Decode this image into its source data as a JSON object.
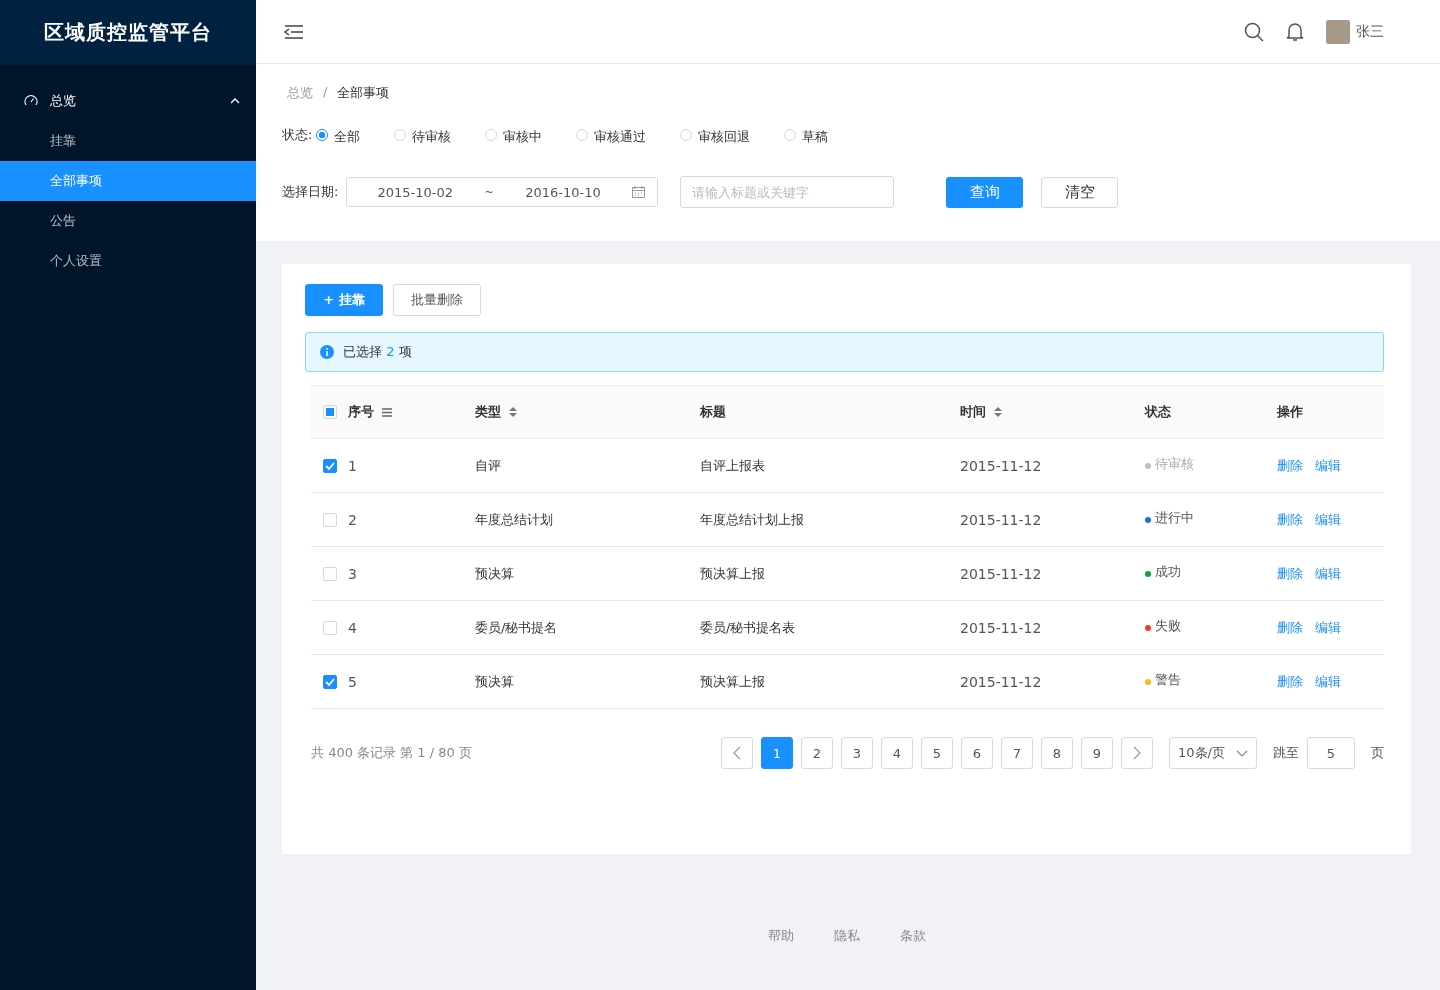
{
  "app": {
    "title": "区域质控监管平台"
  },
  "sidebar": {
    "items": [
      {
        "label": "总览",
        "expanded": true,
        "children": [
          {
            "label": "挂靠",
            "selected": false
          },
          {
            "label": "全部事项",
            "selected": true
          },
          {
            "label": "公告",
            "selected": false
          },
          {
            "label": "个人设置",
            "selected": false
          }
        ]
      }
    ]
  },
  "header": {
    "user": "张三"
  },
  "breadcrumb": [
    "总览",
    "全部事项"
  ],
  "breadcrumb_separator": "/",
  "filters": {
    "status_label": "状态:",
    "statuses": [
      {
        "label": "全部",
        "selected": true
      },
      {
        "label": "待审核",
        "selected": false
      },
      {
        "label": "审核中",
        "selected": false
      },
      {
        "label": "审核通过",
        "selected": false
      },
      {
        "label": "审核回退",
        "selected": false
      },
      {
        "label": "草稿",
        "selected": false
      }
    ],
    "date_label": "选择日期:",
    "date_start": "2015-10-02",
    "date_sep": "~",
    "date_end": "2016-10-10",
    "search": {
      "placeholder": "请输入标题或关键字"
    },
    "buttons": [
      "查询",
      "清空"
    ]
  },
  "toolbar": {
    "add": "+ 挂靠",
    "batch_delete": "批量删除"
  },
  "alert": {
    "text": "已选择",
    "count": "2",
    "suffix": "项"
  },
  "table": {
    "select_all_partial": true,
    "columns": [
      "序号",
      "类型",
      "标题",
      "时间",
      "状态",
      "操作"
    ],
    "rows": [
      {
        "checked": true,
        "cells": [
          "1",
          "自评",
          "自评上报表",
          "2015-11-12"
        ],
        "status": "待审核",
        "color": "#bfbfbf",
        "muted": true,
        "actions": [
          "删除",
          "编辑"
        ]
      },
      {
        "checked": false,
        "cells": [
          "2",
          "年度总结计划",
          "年度总结计划上报",
          "2015-11-12"
        ],
        "status": "进行中",
        "color": "#1273d6",
        "muted": false,
        "actions": [
          "删除",
          "编辑"
        ]
      },
      {
        "checked": false,
        "cells": [
          "3",
          "预决算",
          "预决算上报",
          "2015-11-12"
        ],
        "status": "成功",
        "color": "#10a04c",
        "muted": false,
        "actions": [
          "删除",
          "编辑"
        ]
      },
      {
        "checked": false,
        "cells": [
          "4",
          "委员/秘书提名",
          "委员/秘书提名表",
          "2015-11-12"
        ],
        "status": "失败",
        "color": "#f0392b",
        "muted": false,
        "actions": [
          "删除",
          "编辑"
        ]
      },
      {
        "checked": true,
        "cells": [
          "5",
          "预决算",
          "预决算上报",
          "2015-11-12"
        ],
        "status": "警告",
        "color": "#fcb814",
        "muted": false,
        "actions": [
          "删除",
          "编辑"
        ]
      }
    ]
  },
  "pagination": {
    "summary": "共 400 条记录 第 1 / 80 页",
    "pages": [
      {
        "label": "1",
        "selected": true
      },
      {
        "label": "2",
        "selected": false
      },
      {
        "label": "3",
        "selected": false
      },
      {
        "label": "4",
        "selected": false
      },
      {
        "label": "5",
        "selected": false
      },
      {
        "label": "6",
        "selected": false
      },
      {
        "label": "7",
        "selected": false
      },
      {
        "label": "8",
        "selected": false
      },
      {
        "label": "9",
        "selected": false
      }
    ],
    "page_size": "10条/页",
    "jump_label": "跳至",
    "jump_value": "5",
    "jump_suffix": "页"
  },
  "footer": [
    "帮助",
    "隐私",
    "条款"
  ]
}
